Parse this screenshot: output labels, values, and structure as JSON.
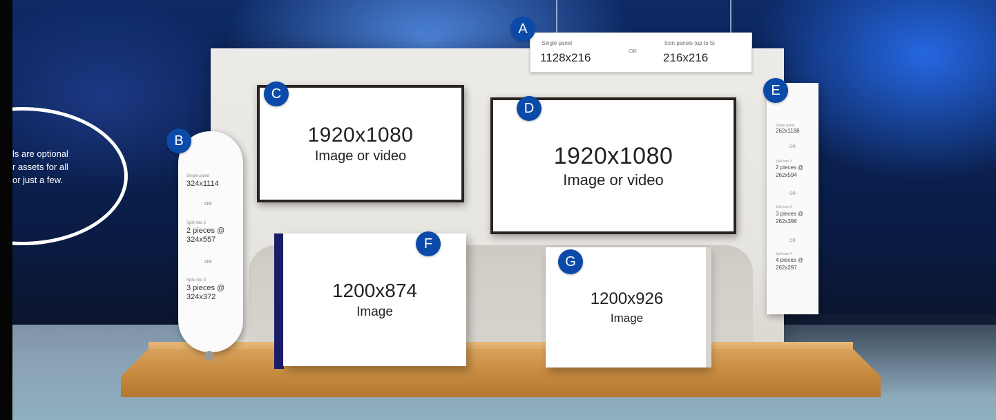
{
  "callout": {
    "lines": [
      "ls are optional",
      "r assets for all",
      "or just a few."
    ]
  },
  "badges": {
    "a": "A",
    "b": "B",
    "c": "C",
    "d": "D",
    "e": "E",
    "f": "F",
    "g": "G"
  },
  "sign_a": {
    "single_label": "Single panel",
    "single_value": "1128x216",
    "or": "OR",
    "icon_label": "Icon panels (up to 5)",
    "icon_value": "216x216"
  },
  "screen_c": {
    "size": "1920x1080",
    "kind": "Image or video"
  },
  "screen_d": {
    "size": "1920x1080",
    "kind": "Image or video"
  },
  "box_f": {
    "size": "1200x874",
    "kind": "Image"
  },
  "box_g": {
    "size": "1200x926",
    "kind": "Image"
  },
  "pill_b": {
    "opt1_label": "Single panel",
    "opt1_value": "324x1114",
    "or1": "OR",
    "opt2_label": "Split into 2",
    "opt2_value_a": "2 pieces @",
    "opt2_value_b": "324x557",
    "or2": "OR",
    "opt3_label": "Split into 3",
    "opt3_value_a": "3 pieces @",
    "opt3_value_b": "324x372"
  },
  "panel_e": {
    "opt1_label": "Single panel",
    "opt1_value": "262x1188",
    "or1": "OR",
    "opt2_label": "Split into 2",
    "opt2_value_a": "2 pieces @",
    "opt2_value_b": "262x594",
    "or2": "OR",
    "opt3_label": "Split into 3",
    "opt3_value_a": "3 pieces @",
    "opt3_value_b": "262x396",
    "or3": "OR",
    "opt4_label": "Split into 4",
    "opt4_value_a": "4 pieces @",
    "opt4_value_b": "262x297"
  },
  "colors": {
    "badge": "#0b4aa8",
    "stage": "#c98d42",
    "wall": "#ecebe8",
    "accent_side": "#1a1e6a"
  }
}
